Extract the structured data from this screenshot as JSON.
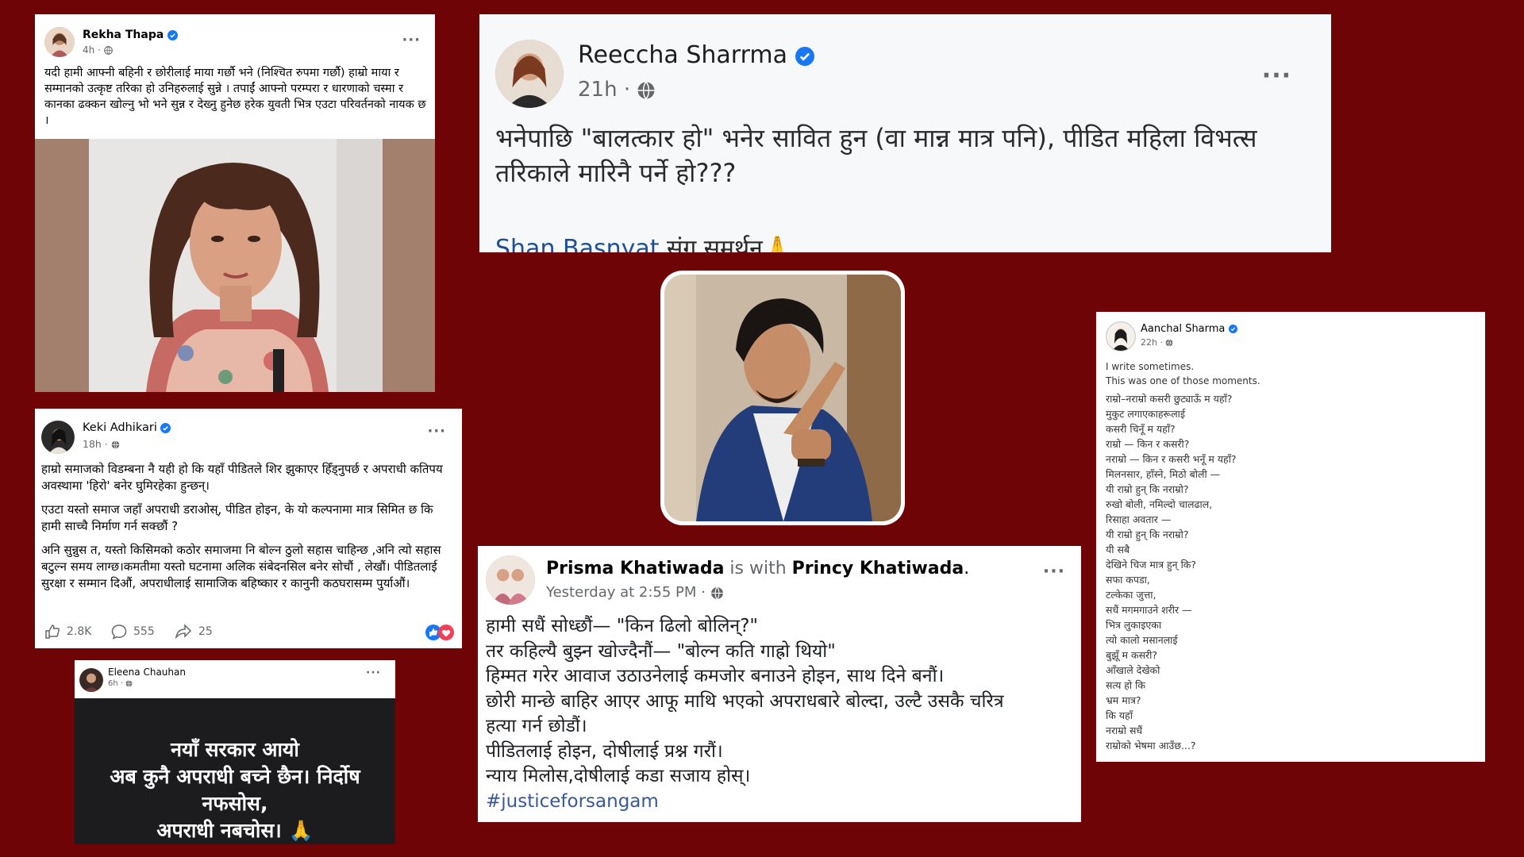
{
  "posts": {
    "rekha": {
      "name": "Rekha Thapa",
      "time": "4h",
      "more": "···",
      "text": "यदी हामी आफ्नी बहिनी र छोरीलाई माया गर्छौ भने (निश्चित रुपमा गर्छौ) हाम्रो माया र सम्मानको उत्कृष्ट तरिका हो उनिहरुलाई सुन्ने । तपाईं आफ्नो परम्परा र धारणाको चस्मा र कानका ढक्कन खोल्नु भो भने सुन्न र देख्नु हुनेछ हरेक युवती भित्र एउटा परिवर्तनको नायक छ ।"
    },
    "reeccha": {
      "name": "Reeccha Sharrma",
      "time": "21h",
      "more": "···",
      "text": "भनेपाछि \"बालत्कार हो\" भनेर सावित हुन (वा मान्न मात्र पनि), पीडित महिला विभत्स तरिकाले मारिनै पर्ने हो???",
      "mention": "Shan Basnyat",
      "mention_suffix": " संग समर्थन",
      "emoji": "🙏"
    },
    "keki": {
      "name": "Keki Adhikari",
      "time": "18h",
      "more": "···",
      "para1": "हाम्रो समाजको विडम्बना नै यही हो कि यहाँ पीडितले शिर झुकाएर हिँड्नुपर्छ र अपराधी कतिपय अवस्थामा 'हिरो' बनेर घुमिरहेका हुन्छन्।",
      "para2": "एउटा यस्तो समाज जहाँ अपराधी डराओस्, पीडित होइन, के यो कल्पनामा मात्र सिमित छ कि हामी साच्चै निर्माण गर्न सक्छौं ?",
      "para3": "अनि सुन्नुस त, यस्तो किसिमको कठोर समाजमा नि बोल्न ठुलो सहास चाहिन्छ ,अनि त्यो सहास बटुल्न समय लाग्छ।कमतीमा यस्तो घटनामा अलिक संबेदनसिल बनेर सोचौं , लेखौं। पीडितलाई सुरक्षा र सम्मान दिऔं, अपराधीलाई सामाजिक बहिष्कार र कानुनी कठघरासम्म पुर्याऔं।",
      "likes": "2.8K",
      "comments": "555",
      "shares": "25"
    },
    "eleena": {
      "name": "Eleena Chauhan",
      "time": "6h",
      "more": "···",
      "line1": "नयाँ सरकार आयो",
      "line2": "अब कुनै अपराधी बच्ने छैन। निर्दोष",
      "line3": "नफसोस,",
      "line4": "अपराधी नबचोस।",
      "emoji": "🙏"
    },
    "prisma": {
      "name": "Prisma Khatiwada",
      "with_word": " is with ",
      "with_name": "Princy Khatiwada",
      "period": ".",
      "time": "Yesterday at 2:55 PM",
      "more": "···",
      "lines": [
        "हामी सधैं सोध्छौं— \"किन ढिलो बोलिन्?\"",
        "तर कहिल्यै बुझ्न खोज्दैनौं— \"बोल्न कति गाह्रो थियो\"",
        "हिम्मत गरेर आवाज उठाउनेलाई कमजोर बनाउने होइन, साथ दिने बनौं।",
        "छोरी मान्छे बाहिर आएर आफू माथि भएको अपराधबारे बोल्दा, उल्टै उसकै चरित्र",
        "हत्या गर्न छोडौं।",
        "पीडितलाई होइन, दोषीलाई प्रश्न गरौं।",
        "न्याय मिलोस,दोषीलाई कडा सजाय होस्।"
      ],
      "hashtag": "#justiceforsangam"
    },
    "aanchal": {
      "name": "Aanchal Sharma",
      "time": "22h",
      "intro1": "I write sometimes.",
      "intro2": "This was one of those moments.",
      "lines": [
        "राम्रो–नराम्रो कसरी छुट्याऊँ म यहाँ?",
        "मुकुट लगाएकाहरूलाई",
        "कसरी चिनूँ म यहाँ?",
        "राम्रो — किन र कसरी?",
        "नराम्रो — किन र कसरी भनूँ म यहाँ?",
        "मिलनसार, हाँस्ने, मिठो बोली —",
        "यी राम्रो हुन् कि नराम्रो?",
        "रुखो बोली, नमिल्दो चालढाल,",
        "रिसाहा अवतार —",
        "यी राम्रो हुन् कि नराम्रो?",
        "यी सबै",
        "देखिने चिज मात्र हुन् कि?",
        "सफा कपडा,",
        "टल्केका जुत्ता,",
        "सधैं मगमगाउने शरीर —",
        "भित्र लुकाइएका",
        "त्यो कालो मसानलाई",
        "बुझूँ म कसरी?",
        "आँखाले देखेको",
        "सत्य हो कि",
        "भ्रम मात्र?",
        "कि यहाँ",
        "नराम्रो सधैं",
        "राम्रोको भेषमा आउँछ...?"
      ]
    }
  },
  "colors": {
    "background": "#6e0406",
    "verified": "#1877f2",
    "link": "#1d4f91",
    "meta": "#65676b"
  },
  "icons": [
    "verified-badge-icon",
    "globe-icon",
    "more-icon",
    "like-icon",
    "comment-icon",
    "share-icon",
    "reaction-like-icon",
    "reaction-love-icon"
  ]
}
